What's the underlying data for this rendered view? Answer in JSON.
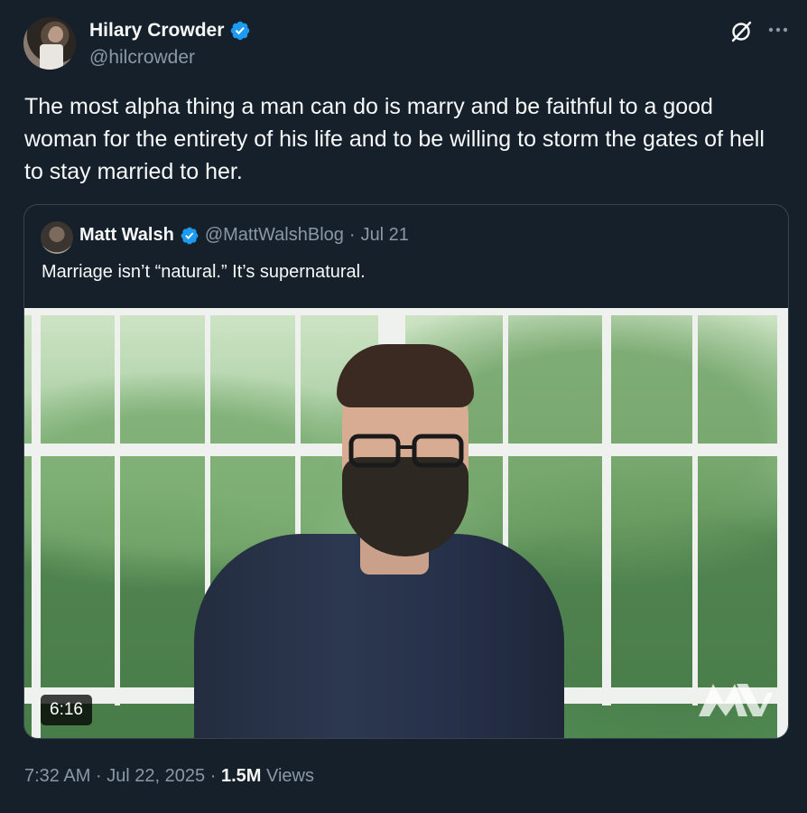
{
  "author": {
    "display_name": "Hilary Crowder",
    "handle": "@hilcrowder",
    "verified": true
  },
  "tweet_text": "The most alpha thing a man can do is marry and be faithful to a good woman for the entirety of his life and to be willing to storm the gates of hell to stay married to her.",
  "quote": {
    "display_name": "Matt Walsh",
    "handle": "@MattWalshBlog",
    "separator": "·",
    "date": "Jul 21",
    "text": "Marriage isn’t “natural.” It’s supernatural.",
    "video": {
      "duration": "6:16"
    }
  },
  "meta": {
    "time": "7:32 AM",
    "sep1": "·",
    "date": "Jul 22, 2025",
    "sep2": "·",
    "views_count": "1.5M",
    "views_label": "Views"
  },
  "colors": {
    "background": "#15202b",
    "text": "#f7f9f9",
    "secondary": "#8b98a5",
    "verified": "#1d9bf0",
    "border": "#38444d"
  },
  "icons": {
    "verified": "verified-badge-icon",
    "grok": "grok-icon",
    "more": "more-horizontal-icon"
  }
}
